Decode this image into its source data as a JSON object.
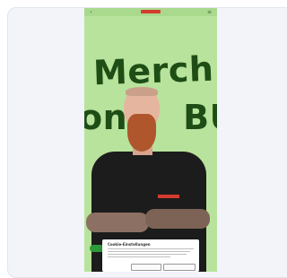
{
  "header": {
    "back_icon": "chevron-left-icon",
    "menu_icon": "menu-icon",
    "brand_color": "#d43b2f"
  },
  "hero": {
    "line1": "Merch",
    "line2_left": "on",
    "line2_right": "BÜ",
    "bg_color": "#b8e39c",
    "text_color": "#1f4d16"
  },
  "cookie_banner": {
    "title": "Cookie-Einstellungen"
  }
}
